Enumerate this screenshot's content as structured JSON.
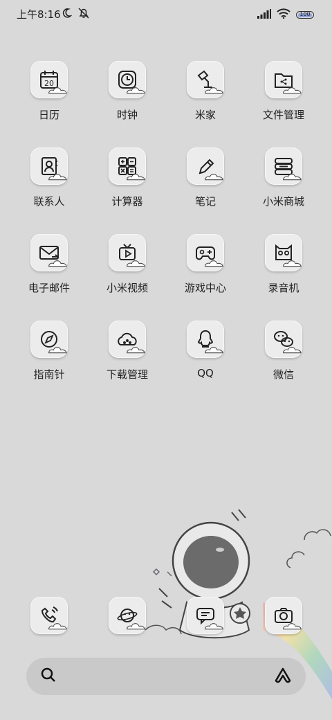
{
  "status_bar": {
    "time": "上午8:16",
    "battery": "100",
    "icons": [
      "moon-icon",
      "mute-bell-icon",
      "signal-icon",
      "wifi-icon",
      "battery-icon"
    ]
  },
  "apps": [
    {
      "label": "日历",
      "icon": "calendar-icon",
      "date": "20"
    },
    {
      "label": "时钟",
      "icon": "clock-icon"
    },
    {
      "label": "米家",
      "icon": "lamp-icon"
    },
    {
      "label": "文件管理",
      "icon": "folder-icon"
    },
    {
      "label": "联系人",
      "icon": "contacts-icon"
    },
    {
      "label": "计算器",
      "icon": "calculator-icon"
    },
    {
      "label": "笔记",
      "icon": "pen-icon"
    },
    {
      "label": "小米商城",
      "icon": "store-icon"
    },
    {
      "label": "电子邮件",
      "icon": "mail-icon"
    },
    {
      "label": "小米视频",
      "icon": "tv-icon"
    },
    {
      "label": "游戏中心",
      "icon": "gamepad-icon"
    },
    {
      "label": "录音机",
      "icon": "recorder-icon"
    },
    {
      "label": "指南针",
      "icon": "compass-icon"
    },
    {
      "label": "下载管理",
      "icon": "download-cloud-icon"
    },
    {
      "label": "QQ",
      "icon": "qq-penguin-icon"
    },
    {
      "label": "微信",
      "icon": "wechat-icon"
    }
  ],
  "dock": [
    {
      "icon": "phone-icon"
    },
    {
      "icon": "browser-planet-icon"
    },
    {
      "icon": "messages-icon"
    },
    {
      "icon": "camera-icon"
    }
  ],
  "search": {
    "left_icon": "search-icon",
    "right_icon": "assistant-icon"
  }
}
